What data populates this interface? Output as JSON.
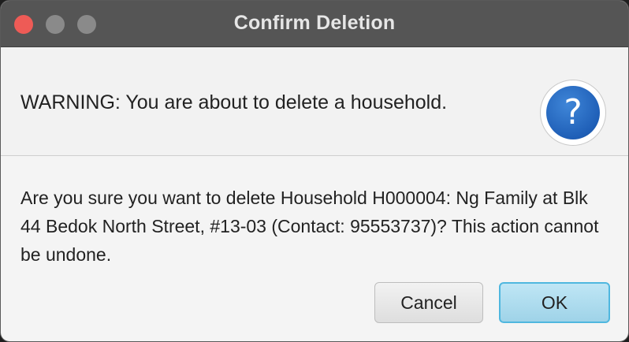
{
  "window": {
    "title": "Confirm Deletion"
  },
  "header": {
    "text": "WARNING: You are about to delete a household.",
    "icon": "question-icon",
    "icon_glyph": "?"
  },
  "content": {
    "message": "Are you sure you want to delete Household H000004: Ng Family at Blk 44 Bedok North Street, #13-03 (Contact: 95553737)? This action cannot be undone."
  },
  "buttons": {
    "cancel_label": "Cancel",
    "ok_label": "OK"
  },
  "colors": {
    "titlebar": "#555555",
    "close": "#ee5b56",
    "icon_blue": "#1f5fb7",
    "ok_border": "#4fb7df"
  }
}
